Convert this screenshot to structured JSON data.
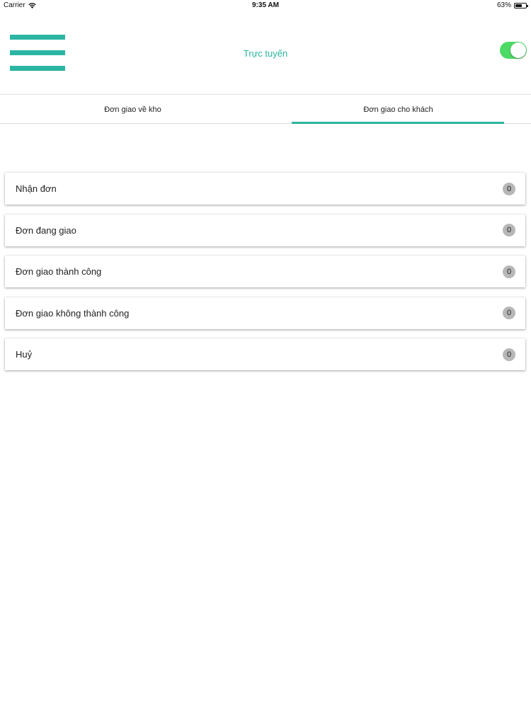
{
  "status_bar": {
    "carrier": "Carrier",
    "wifi_icon": "wifi-icon",
    "time": "9:35 AM",
    "battery_text": "63%",
    "battery_level": 0.63
  },
  "header": {
    "title": "Trực tuyến",
    "menu_icon": "hamburger-menu-icon",
    "online_toggle_on": true,
    "accent_color": "#2bb5a2",
    "toggle_color": "#4cd964"
  },
  "tabs": [
    {
      "label": "Đơn giao về kho",
      "selected": false
    },
    {
      "label": "Đơn giao cho khách",
      "selected": true
    }
  ],
  "order_statuses": [
    {
      "label": "Nhận đơn",
      "count": "0"
    },
    {
      "label": "Đơn đang giao",
      "count": "0"
    },
    {
      "label": "Đơn giao thành công",
      "count": "0"
    },
    {
      "label": "Đơn giao không thành công",
      "count": "0"
    },
    {
      "label": "Huỷ",
      "count": "0"
    }
  ]
}
